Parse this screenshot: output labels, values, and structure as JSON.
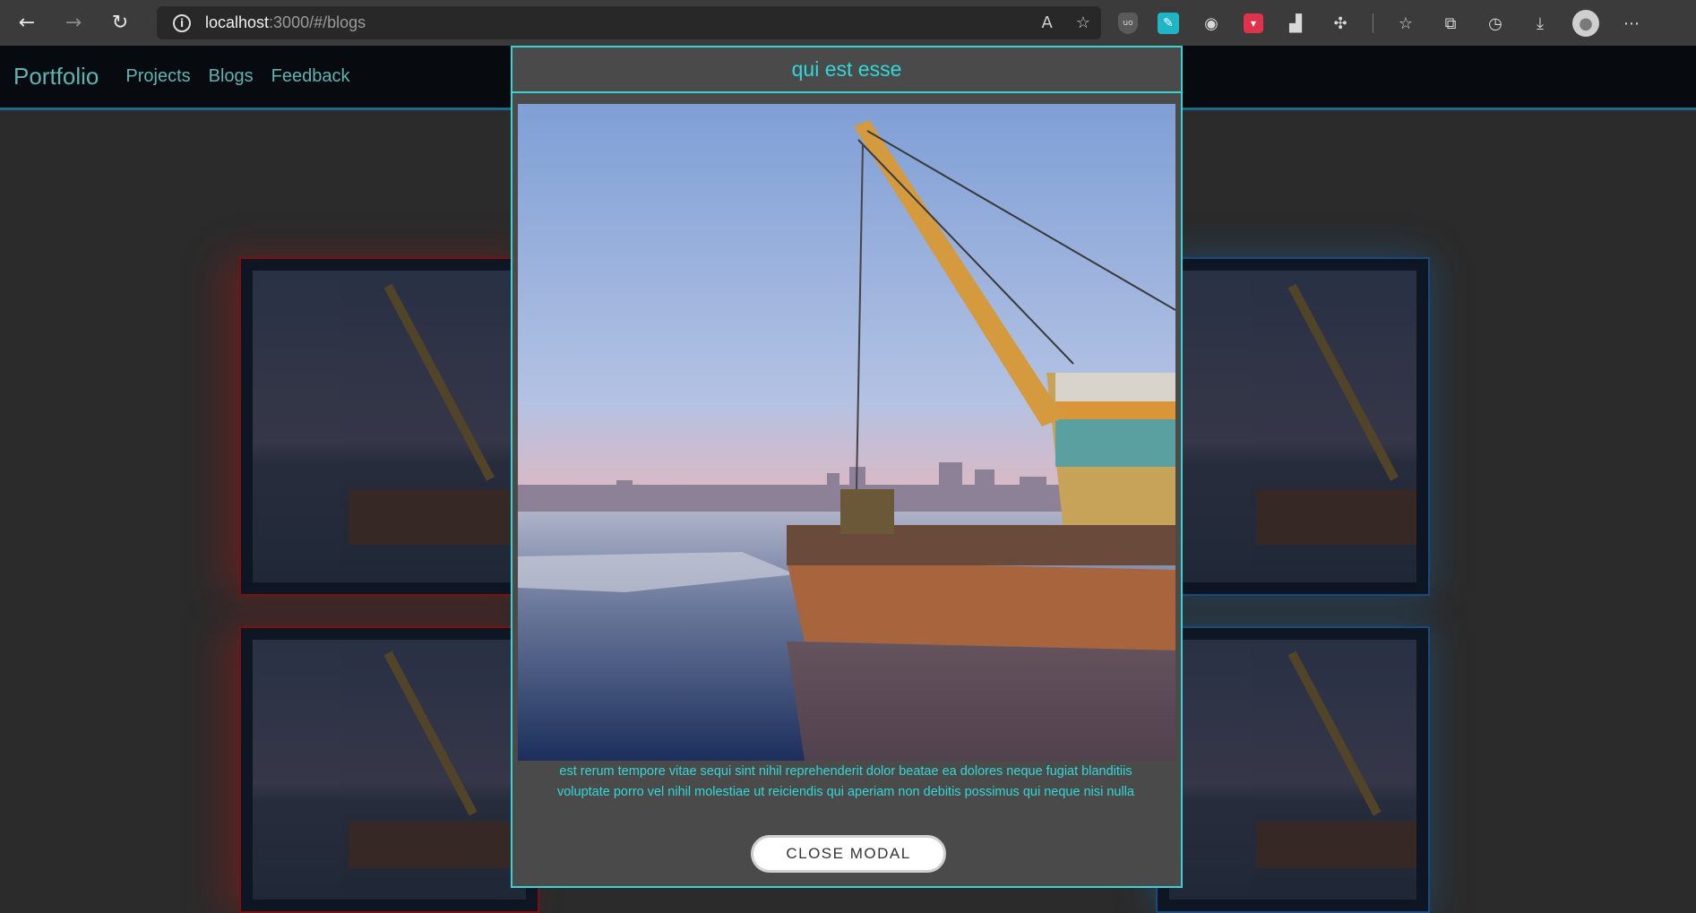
{
  "browser": {
    "url_host": "localhost",
    "url_path": ":3000/#/blogs"
  },
  "site": {
    "brand": "Portfolio",
    "nav": [
      "Projects",
      "Blogs",
      "Feedback"
    ]
  },
  "modal": {
    "title": "qui est esse",
    "body": "est rerum tempore vitae sequi sint nihil reprehenderit dolor beatae ea dolores neque fugiat blanditiis voluptate porro vel nihil molestiae ut reiciendis qui aperiam non debitis possimus qui neque nisi nulla",
    "close_label": "CLOSE MODAL"
  },
  "colors": {
    "accent": "#31d8d8",
    "header_bg": "#070a0f",
    "modal_bg": "#4a4a4a"
  }
}
